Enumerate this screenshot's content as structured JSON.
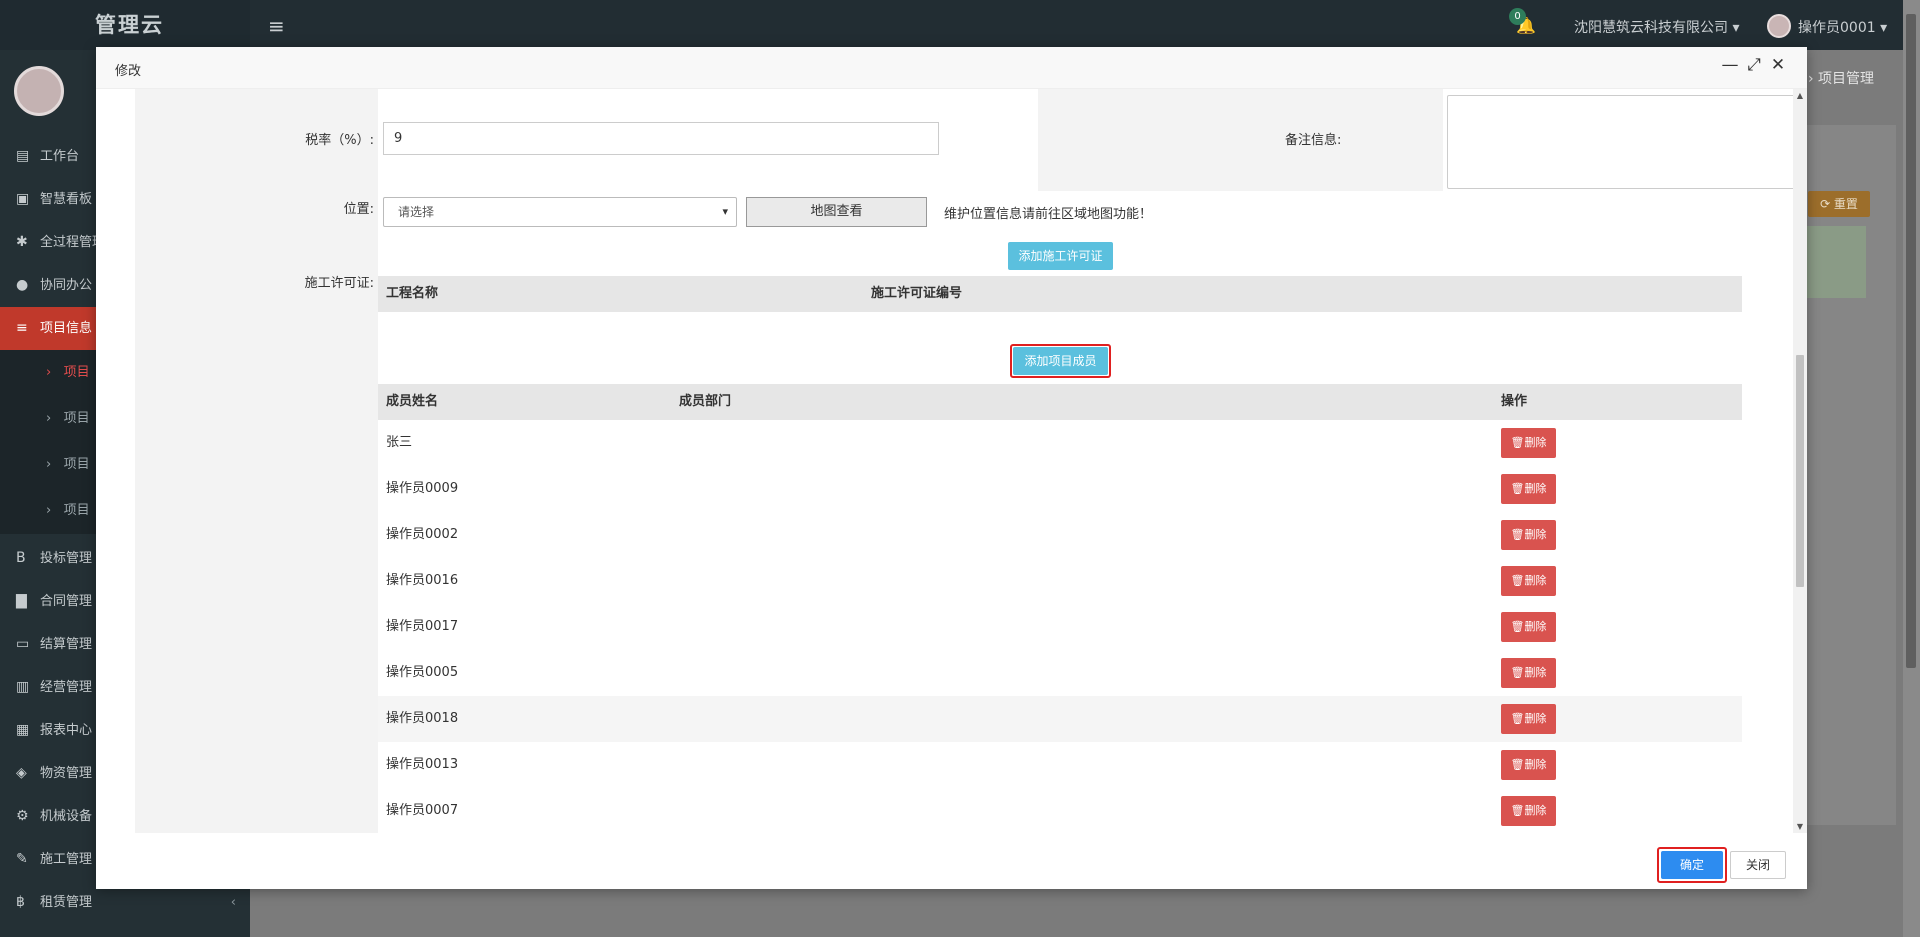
{
  "app": {
    "brand": "管理云",
    "notification_count": "0",
    "company": "沈阳慧筑云科技有限公司",
    "user": "操作员0001"
  },
  "sidebar": {
    "items": [
      {
        "icon": "▤",
        "label": "工作台"
      },
      {
        "icon": "▣",
        "label": "智慧看板"
      },
      {
        "icon": "✱",
        "label": "全过程管理"
      },
      {
        "icon": "●",
        "label": "协同办公"
      },
      {
        "icon": "≡",
        "label": "项目信息"
      },
      {
        "icon": "B",
        "label": "投标管理"
      },
      {
        "icon": "▇",
        "label": "合同管理"
      },
      {
        "icon": "▭",
        "label": "结算管理"
      },
      {
        "icon": "▥",
        "label": "经营管理"
      },
      {
        "icon": "▦",
        "label": "报表中心"
      },
      {
        "icon": "◈",
        "label": "物资管理"
      },
      {
        "icon": "⚙",
        "label": "机械设备"
      },
      {
        "icon": "✎",
        "label": "施工管理"
      },
      {
        "icon": "฿",
        "label": "租赁管理"
      }
    ],
    "sub_items": [
      "项目",
      "项目",
      "项目",
      "项目"
    ]
  },
  "background": {
    "breadcrumb": "› 项目管理",
    "reset_label": "⟳ 重置"
  },
  "modal": {
    "title": "修改",
    "form": {
      "tax_label": "税率（%）:",
      "tax_value": "9",
      "notes_label": "备注信息:",
      "location_label": "位置:",
      "location_placeholder": "请选择",
      "map_button": "地图查看",
      "location_hint": "维护位置信息请前往区域地图功能！",
      "permit_label": "施工许可证:",
      "add_permit_button": "添加施工许可证",
      "permit_columns": [
        "工程名称",
        "施工许可证编号"
      ],
      "add_member_button": "添加项目成员",
      "member_columns": [
        "成员姓名",
        "成员部门",
        "操作"
      ],
      "delete_label": "🗑删除",
      "members": [
        {
          "name": "张三",
          "dept": ""
        },
        {
          "name": "操作员0009",
          "dept": ""
        },
        {
          "name": "操作员0002",
          "dept": ""
        },
        {
          "name": "操作员0016",
          "dept": ""
        },
        {
          "name": "操作员0017",
          "dept": ""
        },
        {
          "name": "操作员0005",
          "dept": ""
        },
        {
          "name": "操作员0018",
          "dept": ""
        },
        {
          "name": "操作员0013",
          "dept": ""
        },
        {
          "name": "操作员0007",
          "dept": ""
        }
      ]
    },
    "confirm_button": "确定",
    "close_button": "关闭"
  }
}
